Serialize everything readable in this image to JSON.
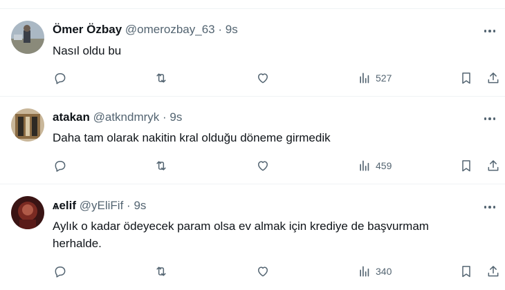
{
  "tweets": [
    {
      "author_name": "Ömer Özbay",
      "handle": "@omerozbay_63",
      "separator": "·",
      "time": "9s",
      "text": "Nasıl oldu bu",
      "views": "527",
      "avatar": "photo of a person in a landscape"
    },
    {
      "author_name": "atakan",
      "handle": "@atkndmryk",
      "separator": "·",
      "time": "9s",
      "text": "Daha tam olarak nakitin kral olduğu döneme girmedik",
      "views": "459",
      "avatar": "photo of a building facade"
    },
    {
      "author_name": "ѧelif",
      "handle": "@yEliFif",
      "separator": "·",
      "time": "9s",
      "text": "Aylık o kadar ödeyecek param olsa ev almak için krediye de başvurmam herhalde.",
      "views": "340",
      "avatar": "dark reddish portrait photo"
    }
  ],
  "icons": {
    "more": "more-icon",
    "reply": "reply-icon",
    "retweet": "retweet-icon",
    "like": "like-icon",
    "views": "views-icon",
    "bookmark": "bookmark-icon",
    "share": "share-icon"
  },
  "colors": {
    "text": "#0f1419",
    "secondary": "#536471",
    "divider": "#eff3f4"
  }
}
